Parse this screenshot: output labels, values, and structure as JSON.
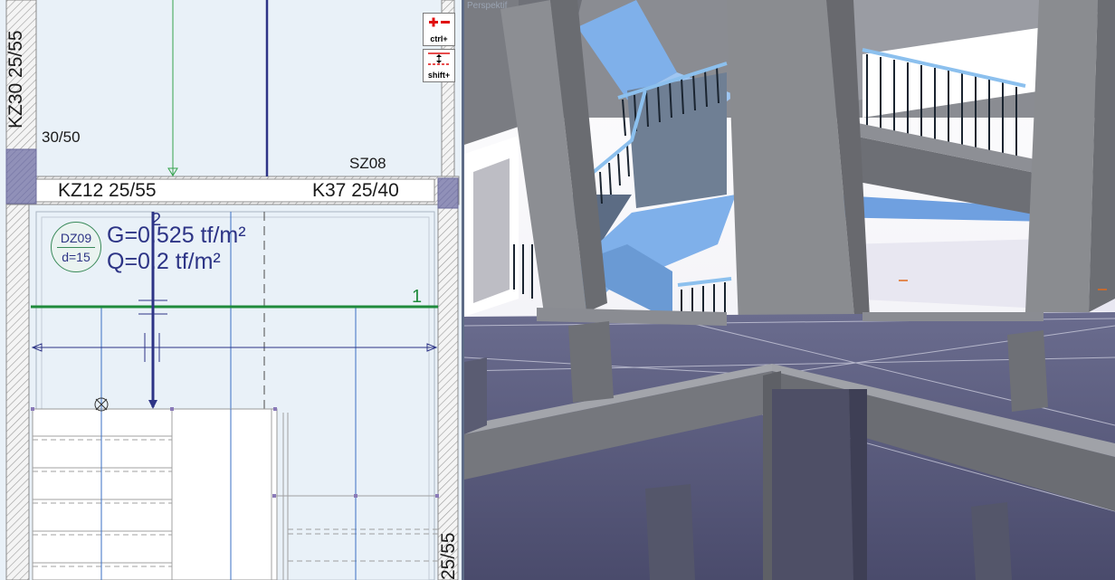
{
  "plan": {
    "labels": {
      "kz30": "KZ30 25/55",
      "col_size": "30/50",
      "kz12": "KZ12 25/55",
      "sz08": "SZ08",
      "k37": "K37 25/40",
      "axis_1": "1",
      "axis_2": "2",
      "bottom_right": "25/55"
    },
    "slab": {
      "name": "DZ09",
      "thickness": "d=15"
    },
    "loads": {
      "g": "G=0.525 tf/m²",
      "q": "Q=0.2 tf/m²"
    },
    "zoom_buttons": [
      {
        "label": "ctrl+",
        "icon": "zoom-plus-minus-icon"
      },
      {
        "label": "shift+",
        "icon": "pan-vertical-icon"
      }
    ]
  },
  "perspective": {
    "title": "Perspektif"
  },
  "colors": {
    "plan_background": "#e9f1f8",
    "beam_hatch": "#8c8c8c",
    "load_text": "#2d3486",
    "axis_green": "#1f8a3c",
    "stair_blue": "#7fb0ea",
    "concrete": "#7c7e83",
    "floor_purple": "#5a5c7e"
  }
}
